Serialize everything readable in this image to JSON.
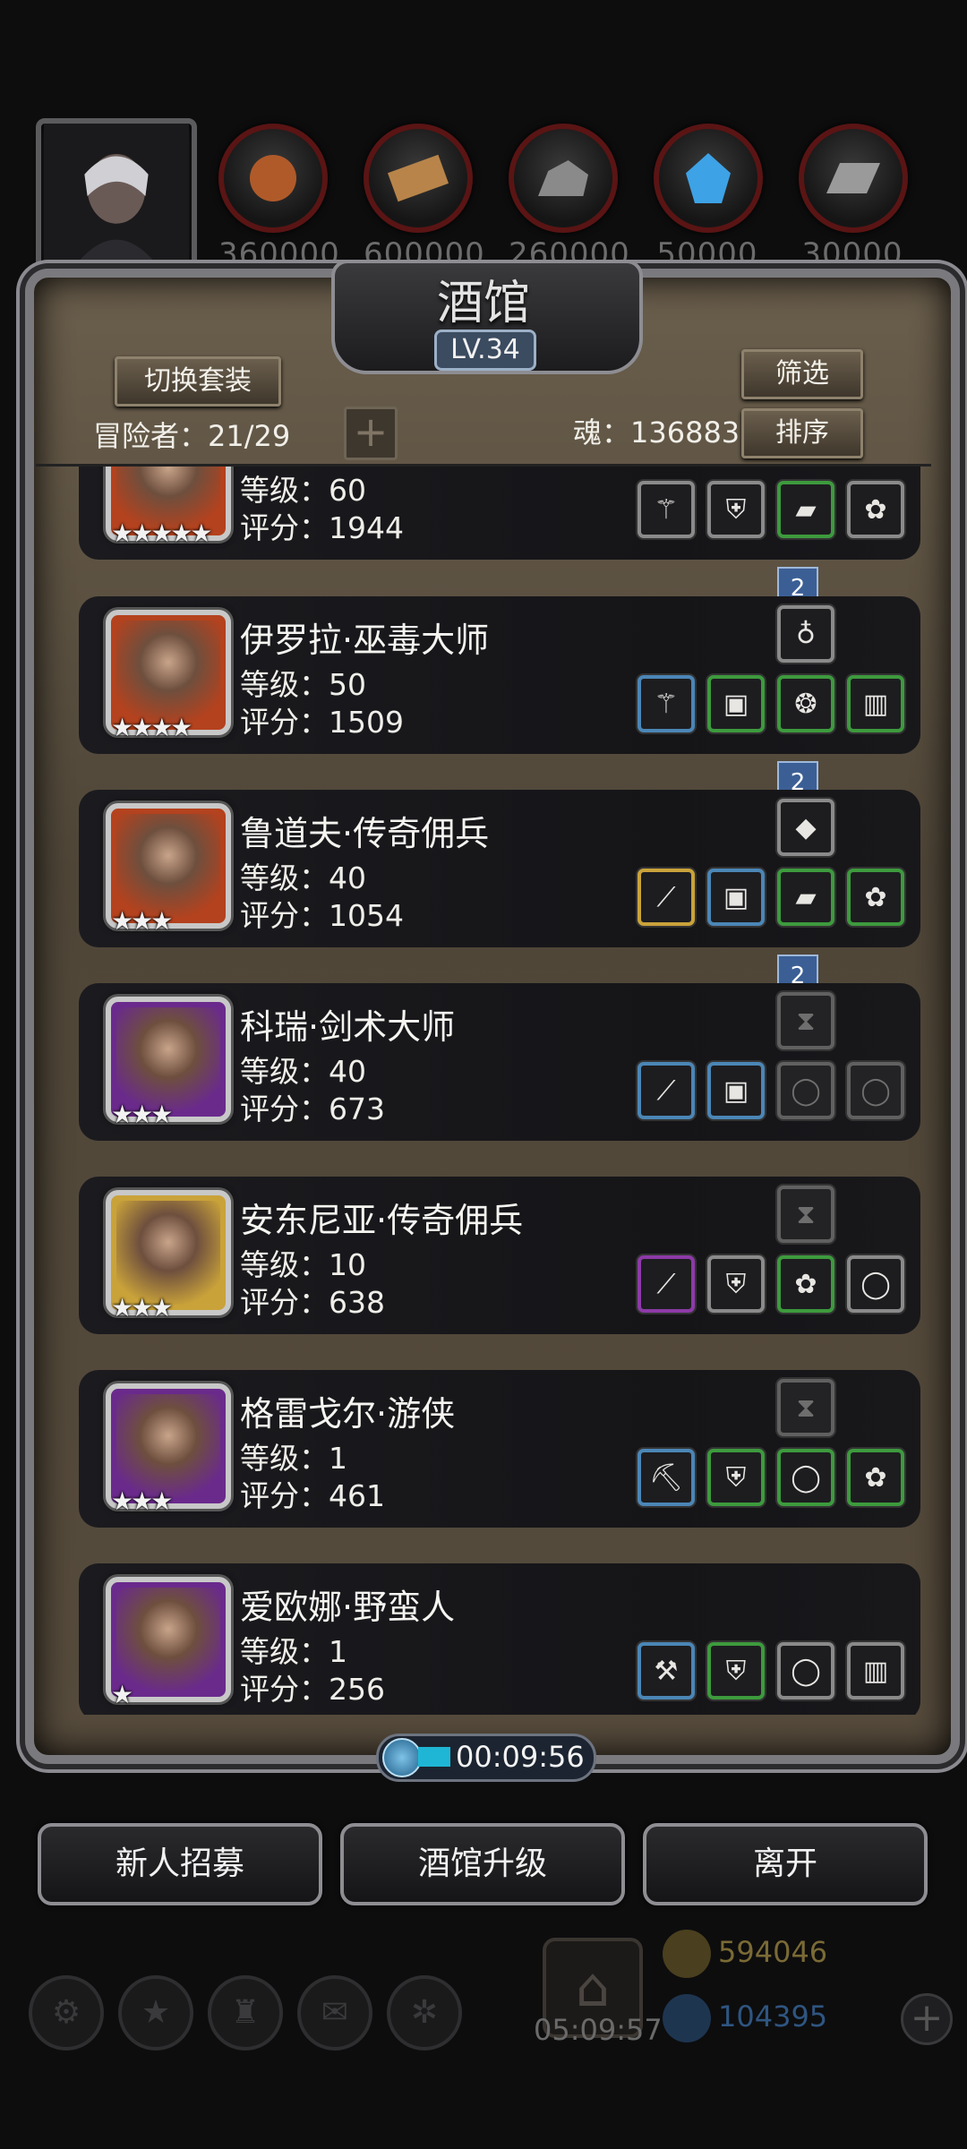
{
  "resources": [
    {
      "icon": "meat-icon",
      "amount": "360000",
      "color": "#b05a2a"
    },
    {
      "icon": "wood-icon",
      "amount": "600000",
      "color": "#b8844a"
    },
    {
      "icon": "stone-icon",
      "amount": "260000",
      "color": "#8a8a8a"
    },
    {
      "icon": "crystal-icon",
      "amount": "50000",
      "color": "#3ea2e6"
    },
    {
      "icon": "iron-icon",
      "amount": "30000",
      "color": "#9a9a9a"
    }
  ],
  "panel": {
    "title": "酒馆",
    "level": "LV.34",
    "switch_outfit_label": "切换套装",
    "filter_label": "筛选",
    "sort_label": "排序",
    "adventurers": "冒险者：21/29",
    "souls": "魂：136883",
    "plus_label": "+"
  },
  "heroes": [
    {
      "name": "",
      "level": "等级：60",
      "score": "评分：1944",
      "stars": "★★★★★",
      "frame": "#b4421e",
      "equip": [
        {
          "i": "staff-icon",
          "c": "gray",
          "g": "⚚"
        },
        {
          "i": "armor-icon",
          "c": "gray",
          "g": "⛨"
        },
        {
          "i": "wood-plank-icon",
          "c": "green",
          "g": "▰"
        },
        {
          "i": "charm-icon",
          "c": "gray",
          "g": "✿"
        }
      ],
      "extra": null,
      "ribbon": "2"
    },
    {
      "name": "伊罗拉·巫毒大师",
      "level": "等级：50",
      "score": "评分：1509",
      "stars": "★★★★",
      "frame": "#b4421e",
      "equip": [
        {
          "i": "staff-icon",
          "c": "blue",
          "g": "⚚"
        },
        {
          "i": "bucket-icon",
          "c": "green",
          "g": "▣"
        },
        {
          "i": "amulet-icon",
          "c": "green",
          "g": "❂"
        },
        {
          "i": "barrel-icon",
          "c": "green",
          "g": "▥"
        }
      ],
      "extra": {
        "i": "pouch-icon",
        "c": "gray",
        "g": "♁"
      },
      "ribbon": "2"
    },
    {
      "name": "鲁道夫·传奇佣兵",
      "level": "等级：40",
      "score": "评分：1054",
      "stars": "★★★",
      "frame": "#b4421e",
      "equip": [
        {
          "i": "dagger-icon",
          "c": "gold",
          "g": "⟋"
        },
        {
          "i": "bucket-icon",
          "c": "blue",
          "g": "▣"
        },
        {
          "i": "wood-plank-icon",
          "c": "green",
          "g": "▰"
        },
        {
          "i": "charm-icon",
          "c": "green",
          "g": "✿"
        }
      ],
      "extra": {
        "i": "stone-icon",
        "c": "gray",
        "g": "◆"
      },
      "ribbon": "2"
    },
    {
      "name": "科瑞·剑术大师",
      "level": "等级：40",
      "score": "评分：673",
      "stars": "★★★",
      "frame": "#6a2a8c",
      "equip": [
        {
          "i": "sword-icon",
          "c": "blue",
          "g": "⟋"
        },
        {
          "i": "bucket-icon",
          "c": "blue",
          "g": "▣"
        },
        {
          "i": "ring-empty-icon",
          "c": "dim",
          "g": "◯"
        },
        {
          "i": "ring-empty-icon",
          "c": "dim",
          "g": "◯"
        }
      ],
      "extra": {
        "i": "hourglass-icon",
        "c": "dim",
        "g": "⧗"
      },
      "ribbon": null
    },
    {
      "name": "安东尼亚·传奇佣兵",
      "level": "等级：10",
      "score": "评分：638",
      "stars": "★★★",
      "frame": "#c9a23a",
      "equip": [
        {
          "i": "dagger-icon",
          "c": "purple",
          "g": "⟋"
        },
        {
          "i": "leather-armor-icon",
          "c": "gray",
          "g": "⛨"
        },
        {
          "i": "charm-icon",
          "c": "green",
          "g": "✿"
        },
        {
          "i": "ring-icon",
          "c": "gray",
          "g": "◯"
        }
      ],
      "extra": {
        "i": "hourglass-icon",
        "c": "dim",
        "g": "⧗"
      },
      "ribbon": null
    },
    {
      "name": "格雷戈尔·游侠",
      "level": "等级：1",
      "score": "评分：461",
      "stars": "★★★",
      "frame": "#6a2a8c",
      "equip": [
        {
          "i": "pickaxe-icon",
          "c": "blue",
          "g": "⛏"
        },
        {
          "i": "armor-icon",
          "c": "green",
          "g": "⛨"
        },
        {
          "i": "ring-icon",
          "c": "green",
          "g": "◯"
        },
        {
          "i": "charm-icon",
          "c": "green",
          "g": "✿"
        }
      ],
      "extra": {
        "i": "hourglass-icon",
        "c": "dim",
        "g": "⧗"
      },
      "ribbon": null
    },
    {
      "name": "爱欧娜·野蛮人",
      "level": "等级：1",
      "score": "评分：256",
      "stars": "★",
      "frame": "#6a2a8c",
      "equip": [
        {
          "i": "axe-icon",
          "c": "blue",
          "g": "⚒"
        },
        {
          "i": "armor-icon",
          "c": "green",
          "g": "⛨"
        },
        {
          "i": "ring-icon",
          "c": "gray",
          "g": "◯"
        },
        {
          "i": "barrel-icon",
          "c": "gray",
          "g": "▥"
        }
      ],
      "extra": null,
      "ribbon": null
    }
  ],
  "timer": "00:09:56",
  "buttons": {
    "recruit": "新人招募",
    "upgrade": "酒馆升级",
    "leave": "离开"
  },
  "hud": {
    "time": "05:09:57",
    "gold": "594046",
    "gems": "104395",
    "gold_color": "#a08a3a",
    "gem_color": "#3a6fb0"
  }
}
